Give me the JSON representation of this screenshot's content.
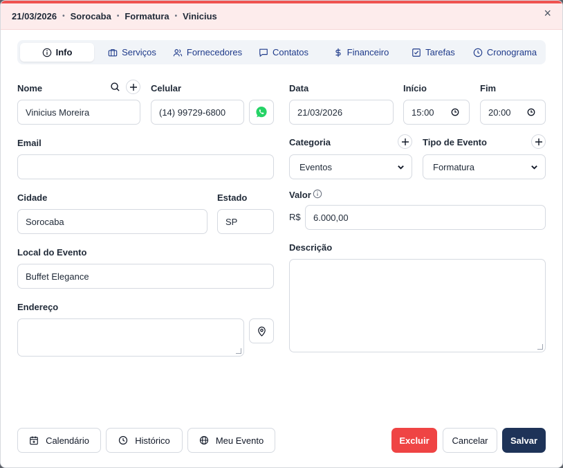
{
  "header": {
    "date": "21/03/2026",
    "city": "Sorocaba",
    "event_type": "Formatura",
    "client": "Vinicius",
    "separator": "•",
    "close": "×"
  },
  "tabs": [
    {
      "label": "Info",
      "icon": "info-icon"
    },
    {
      "label": "Serviços",
      "icon": "briefcase-icon"
    },
    {
      "label": "Fornecedores",
      "icon": "users-icon"
    },
    {
      "label": "Contatos",
      "icon": "message-icon"
    },
    {
      "label": "Financeiro",
      "icon": "dollar-icon"
    },
    {
      "label": "Tarefas",
      "icon": "checkbox-icon"
    },
    {
      "label": "Cronograma",
      "icon": "clock-icon"
    }
  ],
  "form": {
    "nome": {
      "label": "Nome",
      "value": "Vinicius Moreira"
    },
    "celular": {
      "label": "Celular",
      "value": "(14) 99729-6800"
    },
    "data": {
      "label": "Data",
      "value": "21/03/2026"
    },
    "inicio": {
      "label": "Início",
      "value": "15:00"
    },
    "fim": {
      "label": "Fim",
      "value": "20:00"
    },
    "email": {
      "label": "Email",
      "value": ""
    },
    "categoria": {
      "label": "Categoria",
      "value": "Eventos"
    },
    "tipo_evento": {
      "label": "Tipo de Evento",
      "value": "Formatura"
    },
    "cidade": {
      "label": "Cidade",
      "value": "Sorocaba"
    },
    "estado": {
      "label": "Estado",
      "value": "SP"
    },
    "valor": {
      "label": "Valor",
      "prefix": "R$",
      "value": "6.000,00"
    },
    "local": {
      "label": "Local do Evento",
      "value": "Buffet Elegance"
    },
    "descricao": {
      "label": "Descrição",
      "value": ""
    },
    "endereco": {
      "label": "Endereço",
      "value": ""
    }
  },
  "footer": {
    "calendario": "Calendário",
    "historico": "Histórico",
    "meu_evento": "Meu Evento",
    "excluir": "Excluir",
    "cancelar": "Cancelar",
    "salvar": "Salvar"
  },
  "colors": {
    "accent_red": "#ef4444",
    "navy": "#1e3358",
    "whatsapp": "#25d366"
  }
}
